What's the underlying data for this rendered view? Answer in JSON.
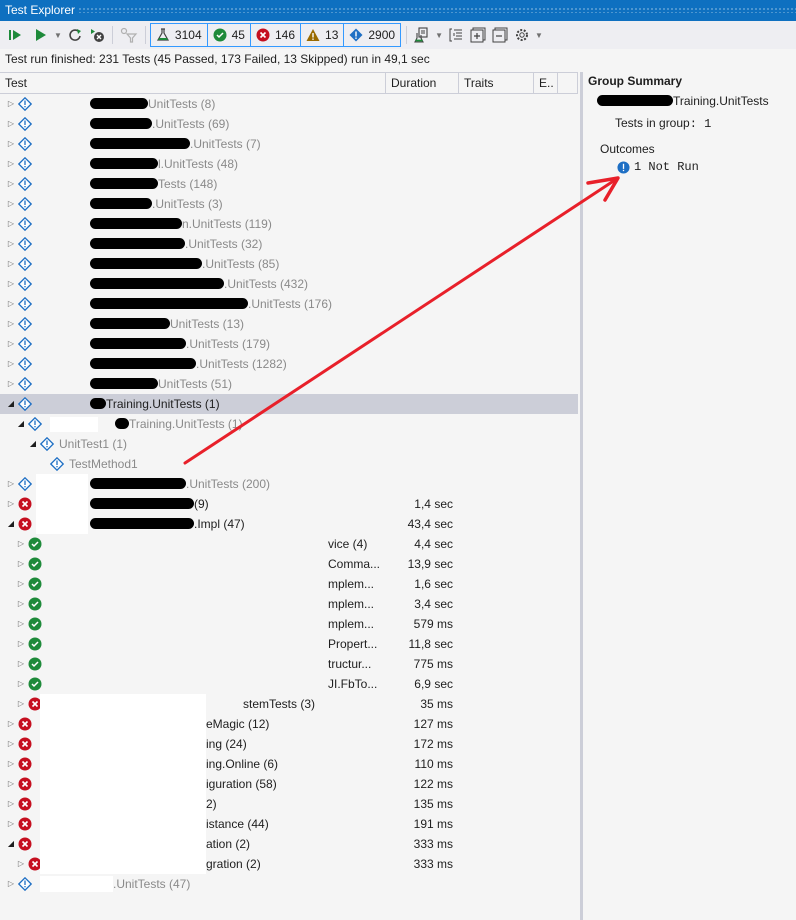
{
  "window": {
    "title": "Test Explorer"
  },
  "toolbar": {
    "buttons": [
      {
        "name": "run-all-icon",
        "label": "Run All"
      },
      {
        "name": "run-icon",
        "label": "Run"
      },
      {
        "name": "rerun-failed-icon",
        "label": "Repeat Last Run"
      },
      {
        "name": "cancel-icon",
        "label": "Cancel"
      },
      {
        "name": "filter-icon",
        "label": "Filter"
      }
    ],
    "counters": {
      "total": "3104",
      "passed": "45",
      "failed": "146",
      "warning": "13",
      "not_run": "2900"
    },
    "right_buttons": [
      {
        "name": "playlist-icon"
      },
      {
        "name": "group-by-icon"
      },
      {
        "name": "expand-all-icon"
      },
      {
        "name": "collapse-all-icon"
      },
      {
        "name": "settings-icon"
      }
    ]
  },
  "status": {
    "text": "Test run finished: 231 Tests (45 Passed, 173 Failed, 13 Skipped) run in 49,1 sec"
  },
  "columns": {
    "test": "Test",
    "duration": "Duration",
    "traits": "Traits",
    "error": "E.."
  },
  "colors": {
    "titlebar": "#0e70c0",
    "counter_border": "#3399ff",
    "passed": "#1e8a3a",
    "failed": "#c50f1f",
    "warning": "#9a6b00",
    "not_run": "#1e6fc4",
    "selection": "#ccced8",
    "annotation_arrow": "#e8202a"
  },
  "rows": [
    {
      "status": "notrun",
      "expanded": false,
      "level": 0,
      "redact": 58,
      "text": "UnitTests (8)",
      "duration": "",
      "dim": true
    },
    {
      "status": "notrun",
      "expanded": false,
      "level": 0,
      "redact": 62,
      "text": ".UnitTests (69)",
      "duration": "",
      "dim": true
    },
    {
      "status": "notrun",
      "expanded": false,
      "level": 0,
      "redact": 100,
      "text": ".UnitTests (7)",
      "duration": "",
      "dim": true
    },
    {
      "status": "notrun",
      "expanded": false,
      "level": 0,
      "redact": 68,
      "text": "l.UnitTests (48)",
      "duration": "",
      "dim": true
    },
    {
      "status": "notrun",
      "expanded": false,
      "level": 0,
      "redact": 68,
      "text": "Tests (148)",
      "duration": "",
      "dim": true
    },
    {
      "status": "notrun",
      "expanded": false,
      "level": 0,
      "redact": 62,
      "text": ".UnitTests (3)",
      "duration": "",
      "dim": true
    },
    {
      "status": "notrun",
      "expanded": false,
      "level": 0,
      "redact": 92,
      "text": "n.UnitTests (119)",
      "duration": "",
      "dim": true
    },
    {
      "status": "notrun",
      "expanded": false,
      "level": 0,
      "redact": 95,
      "text": ".UnitTests (32)",
      "duration": "",
      "dim": true
    },
    {
      "status": "notrun",
      "expanded": false,
      "level": 0,
      "redact": 112,
      "text": ".UnitTests (85)",
      "duration": "",
      "dim": true
    },
    {
      "status": "notrun",
      "expanded": false,
      "level": 0,
      "redact": 134,
      "text": ".UnitTests (432)",
      "duration": "",
      "dim": true
    },
    {
      "status": "notrun",
      "expanded": false,
      "level": 0,
      "redact": 158,
      "text": ".UnitTests (176)",
      "duration": "",
      "dim": true
    },
    {
      "status": "notrun",
      "expanded": false,
      "level": 0,
      "redact": 80,
      "text": "UnitTests (13)",
      "duration": "",
      "dim": true
    },
    {
      "status": "notrun",
      "expanded": false,
      "level": 0,
      "redact": 96,
      "text": ".UnitTests (179)",
      "duration": "",
      "dim": true
    },
    {
      "status": "notrun",
      "expanded": false,
      "level": 0,
      "redact": 106,
      "text": ".UnitTests (1282)",
      "duration": "",
      "dim": true
    },
    {
      "status": "notrun",
      "expanded": false,
      "level": 0,
      "redact": 68,
      "text": "UnitTests (51)",
      "duration": "",
      "dim": true
    },
    {
      "status": "notrun",
      "expanded": true,
      "level": 0,
      "redact": 16,
      "text": "Training.UnitTests (1)",
      "duration": "",
      "dim": false,
      "selected": true
    },
    {
      "status": "notrun",
      "expanded": true,
      "level": 1,
      "redact": 14,
      "text": "Training.UnitTests (1)",
      "duration": "",
      "dim": true
    },
    {
      "status": "notrun",
      "expanded": true,
      "level": 2,
      "redact": 0,
      "text": "UnitTest1 (1)",
      "duration": "",
      "dim": true
    },
    {
      "status": "notrun",
      "expanded": null,
      "level": 3,
      "redact": 0,
      "text": "TestMethod1",
      "duration": "",
      "dim": true
    },
    {
      "status": "notrun",
      "expanded": false,
      "level": 0,
      "redact": 96,
      "text": ".UnitTests (200)",
      "duration": "",
      "dim": true
    },
    {
      "status": "failed",
      "expanded": false,
      "level": 0,
      "redact": 104,
      "text": "(9)",
      "duration": "1,4 sec",
      "dim": false
    },
    {
      "status": "failed",
      "expanded": true,
      "level": 0,
      "redact": 104,
      "text": ".Impl (47)",
      "duration": "43,4 sec",
      "dim": false
    },
    {
      "status": "passed",
      "expanded": false,
      "level": 1,
      "redact": 0,
      "text": "vice (4)",
      "duration": "4,4 sec",
      "dim": false,
      "offset": 328
    },
    {
      "status": "passed",
      "expanded": false,
      "level": 1,
      "redact": 0,
      "text": "Comma...",
      "duration": "13,9 sec",
      "dim": false,
      "offset": 328
    },
    {
      "status": "passed",
      "expanded": false,
      "level": 1,
      "redact": 0,
      "text": "mplem...",
      "duration": "1,6 sec",
      "dim": false,
      "offset": 328
    },
    {
      "status": "passed",
      "expanded": false,
      "level": 1,
      "redact": 0,
      "text": "mplem...",
      "duration": "3,4 sec",
      "dim": false,
      "offset": 328
    },
    {
      "status": "passed",
      "expanded": false,
      "level": 1,
      "redact": 0,
      "text": "mplem...",
      "duration": "579 ms",
      "dim": false,
      "offset": 328
    },
    {
      "status": "passed",
      "expanded": false,
      "level": 1,
      "redact": 0,
      "text": "Propert...",
      "duration": "11,8 sec",
      "dim": false,
      "offset": 328
    },
    {
      "status": "passed",
      "expanded": false,
      "level": 1,
      "redact": 0,
      "text": "tructur...",
      "duration": "775 ms",
      "dim": false,
      "offset": 328
    },
    {
      "status": "passed",
      "expanded": false,
      "level": 1,
      "redact": 0,
      "text": "JI.FbTo...",
      "duration": "6,9 sec",
      "dim": false,
      "offset": 328
    },
    {
      "status": "failed",
      "expanded": false,
      "level": 1,
      "redact": 0,
      "text": "stemTests (3)",
      "duration": "35 ms",
      "dim": false,
      "offset": 243
    },
    {
      "status": "failed",
      "expanded": false,
      "level": 0,
      "redact": 0,
      "text": "eMagic (12)",
      "duration": "127 ms",
      "dim": false,
      "offset": 206
    },
    {
      "status": "failed",
      "expanded": false,
      "level": 0,
      "redact": 0,
      "text": "ing (24)",
      "duration": "172 ms",
      "dim": false,
      "offset": 206
    },
    {
      "status": "failed",
      "expanded": false,
      "level": 0,
      "redact": 0,
      "text": "ing.Online (6)",
      "duration": "110 ms",
      "dim": false,
      "offset": 206
    },
    {
      "status": "failed",
      "expanded": false,
      "level": 0,
      "redact": 0,
      "text": "iguration (58)",
      "duration": "122 ms",
      "dim": false,
      "offset": 206
    },
    {
      "status": "failed",
      "expanded": false,
      "level": 0,
      "redact": 0,
      "text": "2)",
      "duration": "135 ms",
      "dim": false,
      "offset": 206
    },
    {
      "status": "failed",
      "expanded": false,
      "level": 0,
      "redact": 0,
      "text": "istance (44)",
      "duration": "191 ms",
      "dim": false,
      "offset": 206
    },
    {
      "status": "failed",
      "expanded": true,
      "level": 0,
      "redact": 0,
      "text": "ation (2)",
      "duration": "333 ms",
      "dim": false,
      "offset": 206
    },
    {
      "status": "failed",
      "expanded": false,
      "level": 1,
      "redact": 0,
      "text": "gration (2)",
      "duration": "333 ms",
      "dim": false,
      "offset": 206
    },
    {
      "status": "notrun",
      "expanded": false,
      "level": 0,
      "redact": 0,
      "text": ".UnitTests (47)",
      "duration": "",
      "dim": true,
      "offset": 113
    }
  ],
  "summary": {
    "title": "Group Summary",
    "group_name": "Training.UnitTests",
    "tests_in_group_label": "Tests in group",
    "tests_in_group_value": ": 1",
    "outcomes_label": "Outcomes",
    "not_run_text": "1 Not Run"
  }
}
